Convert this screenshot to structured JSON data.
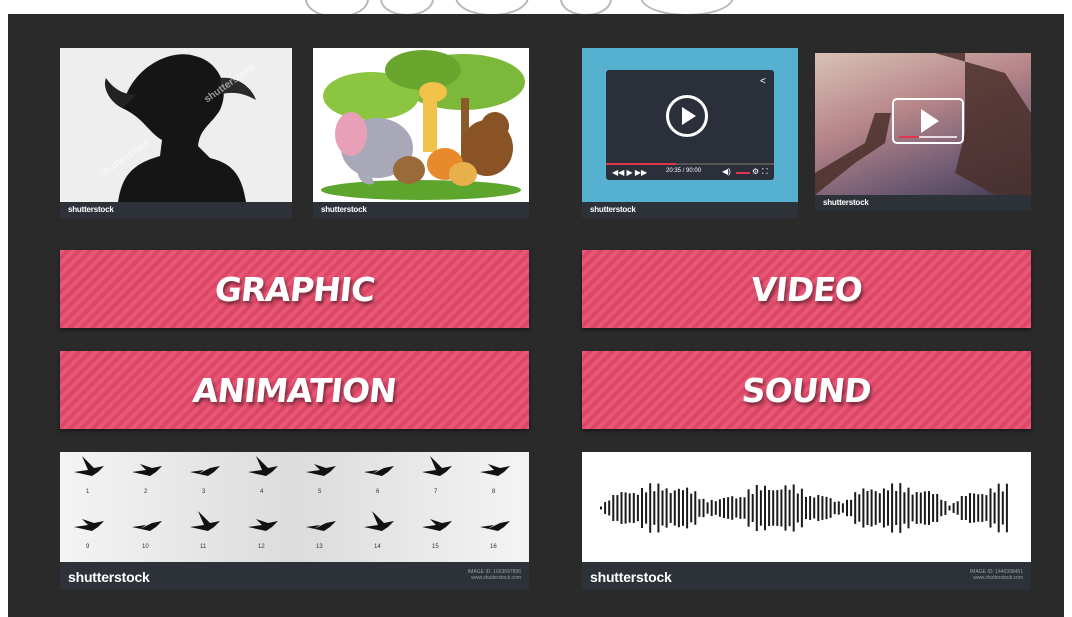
{
  "brand": {
    "logo_text": "shutterstock",
    "accent_color": "#e64a6b",
    "background_color": "#2a2a2a"
  },
  "banners": {
    "graphic": "GRAPHIC",
    "video": "VIDEO",
    "animation": "ANIMATION",
    "sound": "SOUND"
  },
  "video_player": {
    "time": "20:35 / 90:00"
  },
  "bird_frames": [
    "1",
    "2",
    "3",
    "4",
    "5",
    "6",
    "7",
    "8",
    "9",
    "10",
    "11",
    "12",
    "13",
    "14",
    "15",
    "16"
  ],
  "stock_meta": {
    "birds_image_id": "IMAGE ID: 1663697896",
    "sound_image_id": "IMAGE ID: 1446398451",
    "site": "www.shutterstock.com"
  }
}
